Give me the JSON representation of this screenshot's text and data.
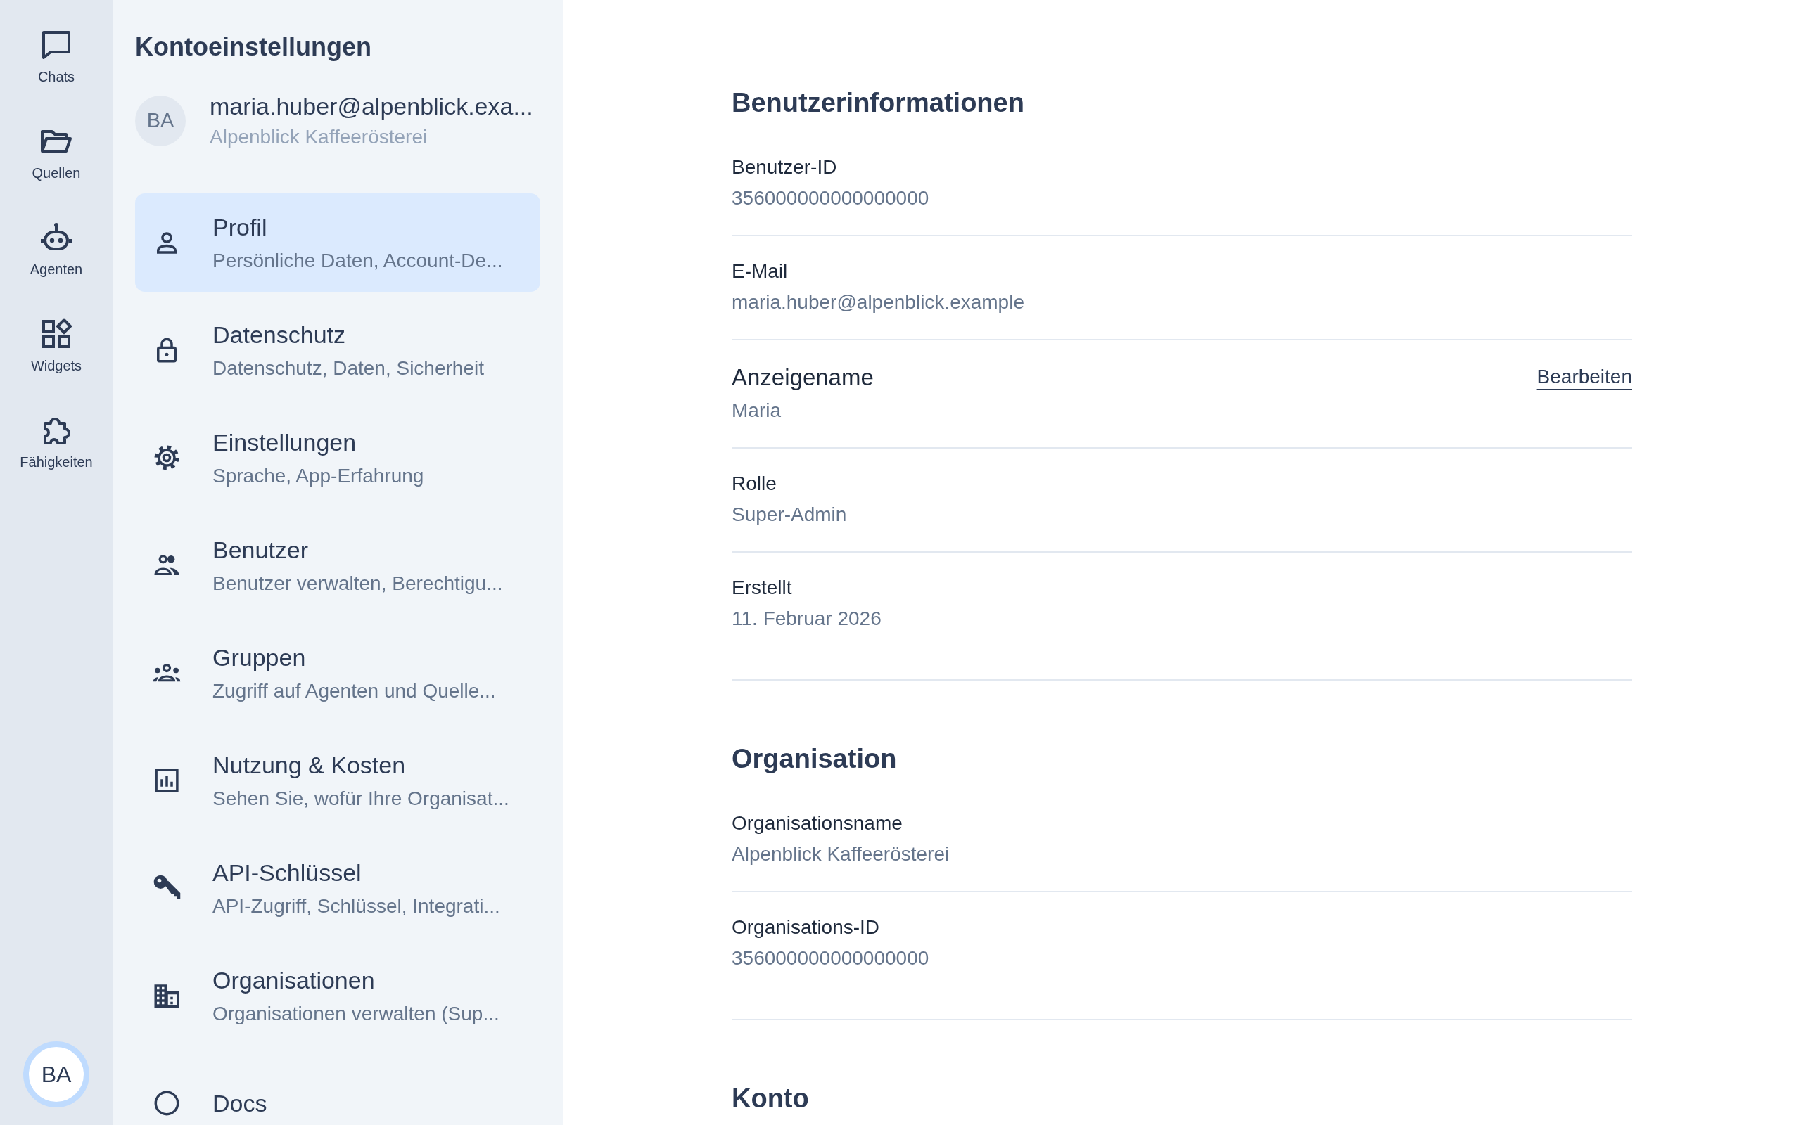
{
  "rail": {
    "items": [
      {
        "label": "Chats"
      },
      {
        "label": "Quellen"
      },
      {
        "label": "Agenten"
      },
      {
        "label": "Widgets"
      },
      {
        "label": "Fähigkeiten"
      }
    ],
    "avatar": "BA"
  },
  "sidebar": {
    "title": "Kontoeinstellungen",
    "account": {
      "initials": "BA",
      "email": "maria.huber@alpenblick.exa...",
      "organization": "Alpenblick Kaffeerösterei"
    },
    "items": [
      {
        "title": "Profil",
        "subtitle": "Persönliche Daten, Account-De...",
        "selected": true
      },
      {
        "title": "Datenschutz",
        "subtitle": "Datenschutz, Daten, Sicherheit",
        "selected": false
      },
      {
        "title": "Einstellungen",
        "subtitle": "Sprache, App-Erfahrung",
        "selected": false
      },
      {
        "title": "Benutzer",
        "subtitle": "Benutzer verwalten, Berechtigu...",
        "selected": false
      },
      {
        "title": "Gruppen",
        "subtitle": "Zugriff auf Agenten und Quelle...",
        "selected": false
      },
      {
        "title": "Nutzung & Kosten",
        "subtitle": "Sehen Sie, wofür Ihre Organisat...",
        "selected": false
      },
      {
        "title": "API-Schlüssel",
        "subtitle": "API-Zugriff, Schlüssel, Integrati...",
        "selected": false
      },
      {
        "title": "Organisationen",
        "subtitle": "Organisationen verwalten (Sup...",
        "selected": false
      },
      {
        "title": "Docs",
        "selected": false
      }
    ]
  },
  "sections": [
    {
      "title": "Benutzerinformationen",
      "fields": [
        {
          "kind": "plain",
          "label": "Benutzer-ID",
          "value": "356000000000000000"
        },
        {
          "kind": "plain",
          "label": "E-Mail",
          "value": "maria.huber@alpenblick.example"
        },
        {
          "kind": "editable",
          "label": "Anzeigename",
          "value": "Maria",
          "action": "Bearbeiten"
        },
        {
          "kind": "plain",
          "label": "Rolle",
          "value": "Super-Admin"
        },
        {
          "kind": "plain",
          "label": "Erstellt",
          "value": "11. Februar 2026"
        }
      ]
    },
    {
      "title": "Organisation",
      "fields": [
        {
          "kind": "plain",
          "label": "Organisationsname",
          "value": "Alpenblick Kaffeerösterei"
        },
        {
          "kind": "plain",
          "label": "Organisations-ID",
          "value": "356000000000000000"
        }
      ]
    },
    {
      "title": "Konto"
    }
  ]
}
